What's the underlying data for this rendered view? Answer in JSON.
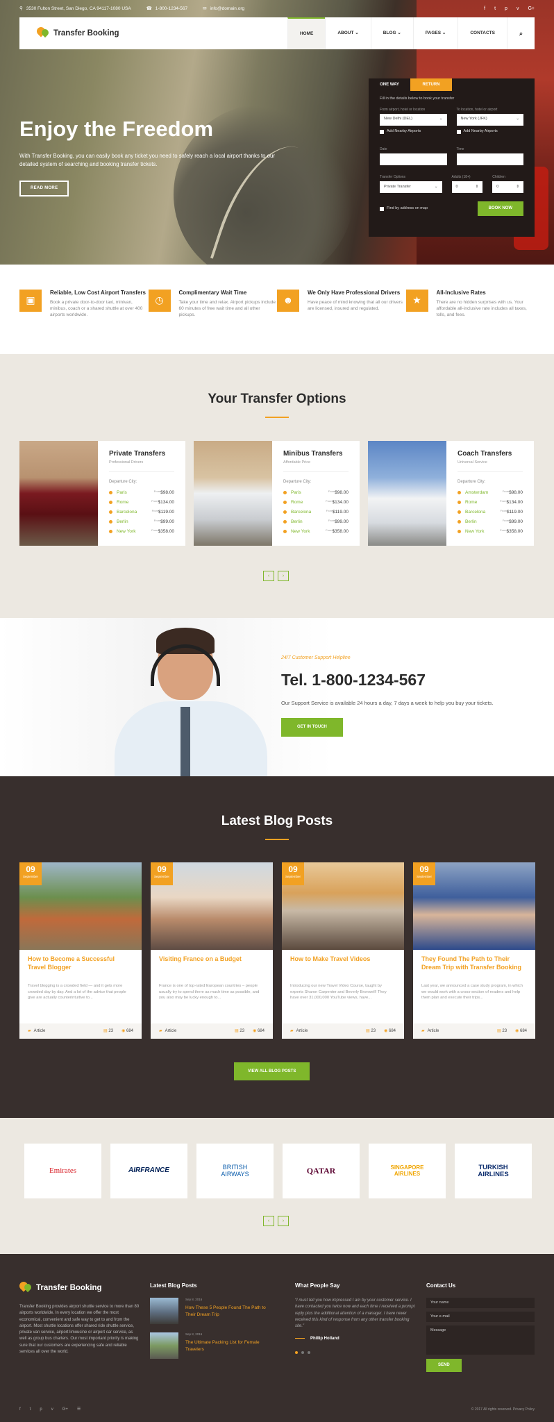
{
  "topbar": {
    "address": "3530 Fulton Street, San Diego, CA 94117-1080 USA",
    "phone": "1-800-1234-567",
    "email": "info@domain.org",
    "social": [
      "f",
      "t",
      "p",
      "v",
      "G+"
    ]
  },
  "nav": {
    "brand": "Transfer Booking",
    "items": [
      "HOME",
      "ABOUT",
      "BLOG",
      "PAGES",
      "CONTACTS"
    ]
  },
  "hero": {
    "title": "Enjoy the Freedom",
    "text": "With Transfer Booking, you can easily book any ticket you need to safely reach a local airport thanks to our detailed system of searching and booking transfer tickets.",
    "button": "READ MORE"
  },
  "booking": {
    "tab_oneway": "ONE WAY",
    "tab_return": "RETURN",
    "hint": "Fill in the details below to book your transfer",
    "from_label": "From airport, hotel or location",
    "from_value": "New Delhi (DEL)",
    "to_label": "To location, hotel or airport",
    "to_value": "New York (JFK)",
    "nearby": "Add Nearby Airports",
    "date_label": "Date",
    "time_label": "Time",
    "options_label": "Transfer Options",
    "options_value": "Private Transfer",
    "adults_label": "Adults (18+)",
    "adults_value": "0",
    "children_label": "Children",
    "children_value": "0",
    "find_label": "Find by address on map",
    "submit": "BOOK NOW"
  },
  "features": [
    {
      "title": "Reliable, Low Cost Airport Transfers",
      "text": "Book a private door-to-door taxi, minivan, minibus, coach or a shared shuttle at over 400 airports worldwide.",
      "icon": "bus-icon"
    },
    {
      "title": "Complimentary Wait Time",
      "text": "Take your time and relax. Airport pickups include 60 minutes of free wait time and all other pickups.",
      "icon": "clock-icon"
    },
    {
      "title": "We Only Have Professional Drivers",
      "text": "Have peace of mind knowing that all our drivers are licensed, insured and regulated.",
      "icon": "users-icon"
    },
    {
      "title": "All-Inclusive Rates",
      "text": "There are no hidden surprises with us. Your affordable all-inclusive rate includes all taxes, tolls, and fees.",
      "icon": "star-icon"
    }
  ],
  "options": {
    "title": "Your Transfer Options",
    "dep_label": "Departure City:",
    "from_label": "From",
    "cards": [
      {
        "title": "Private Transfers",
        "sub": "Professional Drivers",
        "cities": [
          "Paris",
          "Rome",
          "Barcelona",
          "Berlin",
          "New York"
        ],
        "prices": [
          "$98.00",
          "$134.00",
          "$119.00",
          "$99.00",
          "$358.00"
        ]
      },
      {
        "title": "Minibus Transfers",
        "sub": "Affordable Price",
        "cities": [
          "Paris",
          "Rome",
          "Barcelona",
          "Berlin",
          "New York"
        ],
        "prices": [
          "$98.00",
          "$134.00",
          "$119.00",
          "$99.00",
          "$358.00"
        ]
      },
      {
        "title": "Coach Transfers",
        "sub": "Universal Service",
        "cities": [
          "Amsterdam",
          "Rome",
          "Barcelona",
          "Berlin",
          "New York"
        ],
        "prices": [
          "$98.00",
          "$134.00",
          "$119.00",
          "$99.00",
          "$358.00"
        ]
      }
    ]
  },
  "support": {
    "kicker": "24/7 Customer Support Helpline",
    "phone": "Tel. 1-800-1234-567",
    "text": "Our Support Service is available 24 hours a day, 7 days a week to help you buy your tickets.",
    "button": "GET IN TOUCH"
  },
  "blog": {
    "title": "Latest Blog Posts",
    "button": "VIEW ALL BLOG POSTS",
    "posts": [
      {
        "day": "09",
        "month": "September",
        "title": "How to Become a Successful Travel Blogger",
        "excerpt": "Travel blogging is a crowded field — and it gets more crowded day by day. And a lot of the advice that people give are actually counterintuitive to...",
        "cat": "Article",
        "comments": "23",
        "views": "684"
      },
      {
        "day": "09",
        "month": "September",
        "title": "Visiting France on a Budget",
        "excerpt": "France is one of top-rated European countries – people usually try to spend there as much time as possible, and you also may be lucky enough to...",
        "cat": "Article",
        "comments": "23",
        "views": "684"
      },
      {
        "day": "09",
        "month": "September",
        "title": "How to Make Travel Videos",
        "excerpt": "Introducing our new Travel Video Course, taught by experts Sharon Carpenter and Beverly Bronwell! They have over 31,000,000 YouTube views, have...",
        "cat": "Article",
        "comments": "23",
        "views": "684"
      },
      {
        "day": "09",
        "month": "September",
        "title": "They Found The Path to Their Dream Trip with Transfer Booking",
        "excerpt": "Last year, we announced a case study program, in which we would work with a cross-section of readers and help them plan and execute their trips...",
        "cat": "Article",
        "comments": "23",
        "views": "684"
      }
    ]
  },
  "partners": [
    "Emirates",
    "AIRFRANCE",
    "BRITISH AIRWAYS",
    "QATAR",
    "SINGAPORE AIRLINES",
    "TURKISH AIRLINES"
  ],
  "footer": {
    "about": "Transfer Booking provides airport shuttle service to more than 80 airports worldwide. In every location we offer the most economical, convenient and safe way to get to and from the airport. Most shuttle locations offer shared ride shuttle service, private van service, airport limousine or airport car service, as well as group bus charters. Our most important priority is making sure that our customers are experiencing safe and reliable services all over the world.",
    "blog_title": "Latest Blog Posts",
    "blog": [
      {
        "date": "Sep 8, 2016",
        "title": "How These 5 People Found The Path to Their Dream Trip"
      },
      {
        "date": "Sep 8, 2016",
        "title": "The Ultimate Packing List for Female Travelers"
      }
    ],
    "say_title": "What People Say",
    "quote": "“I must tell you how impressed I am by your customer service. I have contacted you twice now and each time I received a prompt reply plus the additional attention of a manager. I have never received this kind of response from any other transfer booking site.”",
    "author": "Phillip Holland",
    "contact_title": "Contact Us",
    "name_ph": "Your name",
    "email_ph": "Your e-mail",
    "msg_ph": "Message",
    "send": "SEND",
    "copyright": "© 2017 All rights reserved. Privacy Policy",
    "social": [
      "f",
      "t",
      "p",
      "v",
      "G+",
      "rss"
    ]
  },
  "colors": {
    "accent": "#f2a122",
    "green": "#7fb72b",
    "dark": "#382f2d"
  }
}
